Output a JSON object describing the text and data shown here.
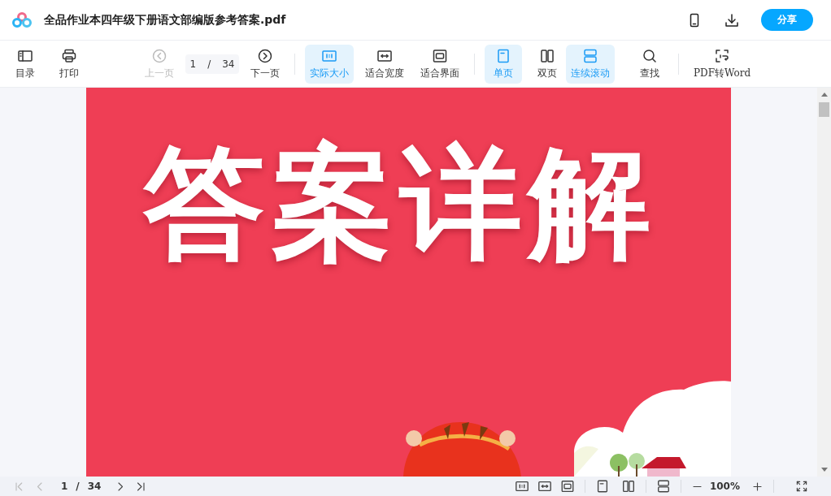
{
  "header": {
    "title": "全品作业本四年级下册语文部编版参考答案.pdf",
    "share_button": "分享"
  },
  "toolbar": {
    "groups": [
      [
        {
          "kind": "tool",
          "label": "目录",
          "selected": false,
          "disabled": false
        },
        {
          "kind": "tool",
          "label": "打印",
          "selected": false,
          "disabled": false
        }
      ],
      [
        {
          "kind": "tool",
          "label": "上一页",
          "selected": false,
          "disabled": true
        },
        {
          "kind": "pager",
          "current": "1",
          "separator": "/",
          "total": "34"
        },
        {
          "kind": "tool",
          "label": "下一页",
          "selected": false,
          "disabled": false
        }
      ],
      [
        {
          "kind": "tool",
          "label": "实际大小",
          "selected": true,
          "disabled": false
        },
        {
          "kind": "tool",
          "label": "适合宽度",
          "selected": false,
          "disabled": false
        },
        {
          "kind": "tool",
          "label": "适合界面",
          "selected": false,
          "disabled": false
        }
      ],
      [
        {
          "kind": "tool",
          "label": "单页",
          "selected": true,
          "disabled": false
        },
        {
          "kind": "tool",
          "label": "双页",
          "selected": false,
          "disabled": false
        }
      ],
      [
        {
          "kind": "tool",
          "label": "连续滚动",
          "selected": true,
          "disabled": false
        },
        {
          "kind": "tool",
          "label": "查找",
          "selected": false,
          "disabled": false
        }
      ],
      [
        {
          "kind": "tool",
          "label": "PDF转Word",
          "selected": false,
          "disabled": false
        }
      ]
    ]
  },
  "document": {
    "heading": "答案详解"
  },
  "footer": {
    "first_disabled": true,
    "prev_disabled": true,
    "current": "1",
    "separator": "/",
    "total": "34",
    "zoom": "100%"
  }
}
